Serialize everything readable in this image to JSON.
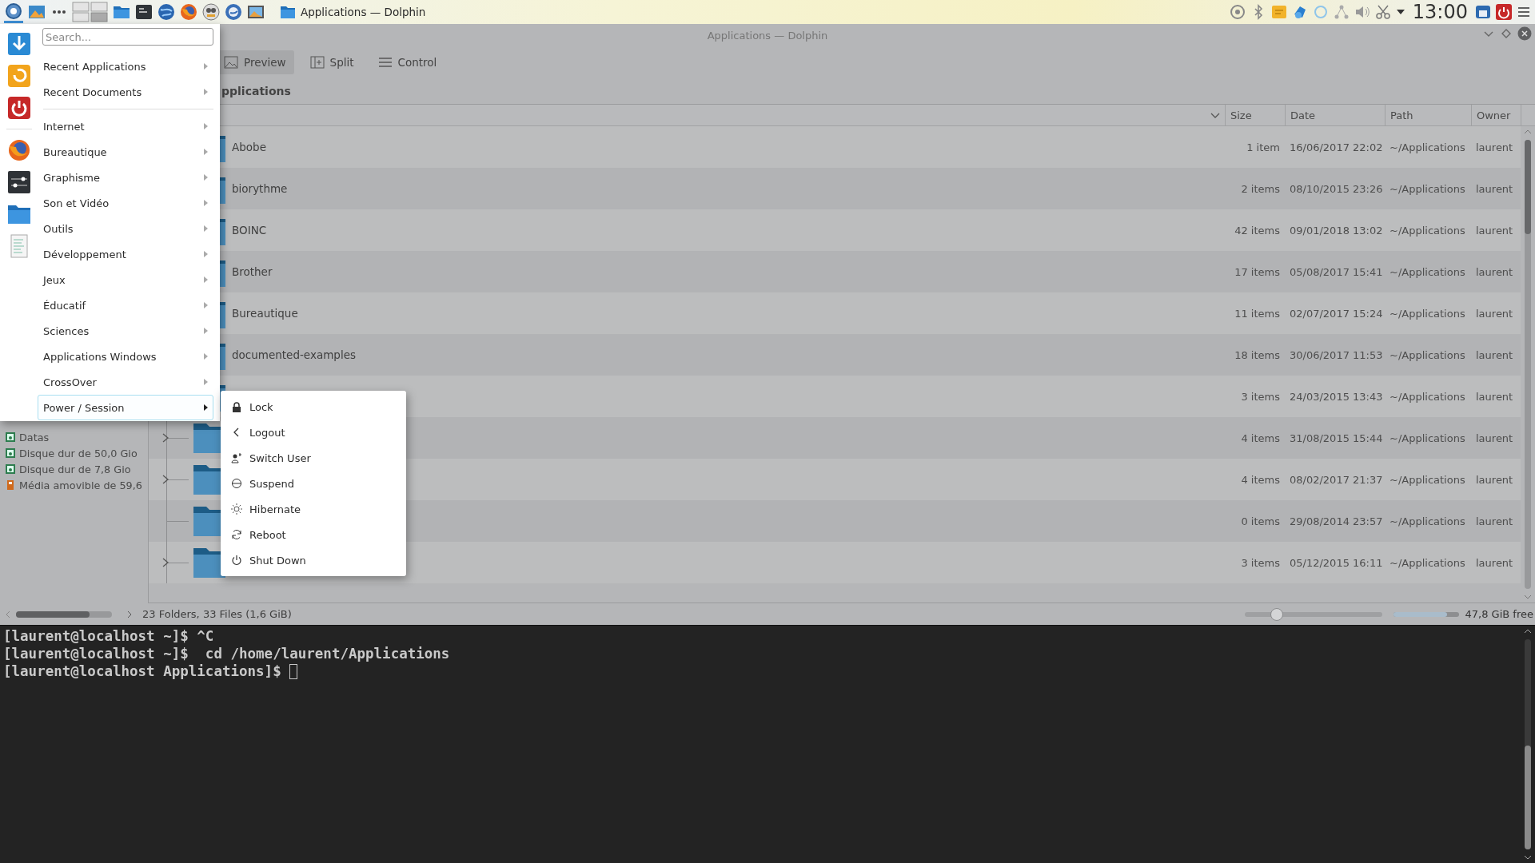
{
  "top_panel": {
    "task": {
      "title": "Applications — Dolphin"
    },
    "clock": "13:00"
  },
  "window": {
    "title": "Applications — Dolphin"
  },
  "toolbar": [
    {
      "label": "Preview",
      "on": true
    },
    {
      "label": "Split",
      "on": false
    },
    {
      "label": "Control",
      "on": false
    }
  ],
  "breadcrumb": "pplications",
  "columns": [
    "Size",
    "Date",
    "Path",
    "Owner"
  ],
  "rows": [
    {
      "name": "Abobe",
      "size": "1 item",
      "date": "16/06/2017 22:02",
      "path": "~/Applications",
      "owner": "laurent",
      "expandable": false
    },
    {
      "name": "biorythme",
      "size": "2 items",
      "date": "08/10/2015 23:26",
      "path": "~/Applications",
      "owner": "laurent",
      "expandable": false
    },
    {
      "name": "BOINC",
      "size": "42 items",
      "date": "09/01/2018 13:02",
      "path": "~/Applications",
      "owner": "laurent",
      "expandable": false
    },
    {
      "name": "Brother",
      "size": "17 items",
      "date": "05/08/2017 15:41",
      "path": "~/Applications",
      "owner": "laurent",
      "expandable": false
    },
    {
      "name": "Bureautique",
      "size": "11 items",
      "date": "02/07/2017 15:24",
      "path": "~/Applications",
      "owner": "laurent",
      "expandable": false
    },
    {
      "name": "documented-examples",
      "size": "18 items",
      "date": "30/06/2017 11:53",
      "path": "~/Applications",
      "owner": "laurent",
      "expandable": false
    },
    {
      "size": "3 items",
      "date": "24/03/2015 13:43",
      "path": "~/Applications",
      "owner": "laurent",
      "expandable": false
    },
    {
      "size": "4 items",
      "date": "31/08/2015 15:44",
      "path": "~/Applications",
      "owner": "laurent",
      "expandable": true
    },
    {
      "size": "4 items",
      "date": "08/02/2017 21:37",
      "path": "~/Applications",
      "owner": "laurent",
      "expandable": true
    },
    {
      "size": "0 items",
      "date": "29/08/2014 23:57",
      "path": "~/Applications",
      "owner": "laurent",
      "expandable": false
    },
    {
      "size": "3 items",
      "date": "05/12/2015 16:11",
      "path": "~/Applications",
      "owner": "laurent",
      "expandable": true
    }
  ],
  "places": [
    "Datas",
    "Disque dur de 50,0 Gio",
    "Disque dur de 7,8 Gio",
    "Média amovible de 59,6"
  ],
  "status_bar": {
    "summary": "23 Folders, 33 Files (1,6 GiB)",
    "zoom": {
      "level": 0.21
    },
    "free_space": {
      "level": 0.82,
      "label": "47,8 GiB free"
    }
  },
  "terminal": {
    "lines": [
      "[laurent@localhost ~]$ ^C",
      "[laurent@localhost ~]$  cd /home/laurent/Applications",
      "[laurent@localhost Applications]$ "
    ]
  },
  "start_menu": {
    "search": {
      "placeholder": "Search..."
    },
    "sections": [
      {
        "items": [
          {
            "label": "Recent Applications",
            "selected": false
          },
          {
            "label": "Recent Documents",
            "selected": false
          }
        ]
      },
      {
        "items": [
          {
            "label": "Internet",
            "selected": false
          },
          {
            "label": "Bureautique",
            "selected": false
          },
          {
            "label": "Graphisme",
            "selected": false
          },
          {
            "label": "Son et Vidéo",
            "selected": false
          },
          {
            "label": "Outils",
            "selected": false
          },
          {
            "label": "Développement",
            "selected": false
          },
          {
            "label": "Jeux",
            "selected": false
          },
          {
            "label": "Éducatif",
            "selected": false
          },
          {
            "label": "Sciences",
            "selected": false
          },
          {
            "label": "Applications Windows",
            "selected": false
          },
          {
            "label": "CrossOver",
            "selected": false
          },
          {
            "label": "Power / Session",
            "selected": true
          }
        ]
      }
    ]
  },
  "power_menu": {
    "items": [
      {
        "label": "Lock"
      },
      {
        "label": "Logout"
      },
      {
        "label": "Switch User"
      },
      {
        "label": "Suspend"
      },
      {
        "label": "Hibernate"
      },
      {
        "label": "Reboot"
      },
      {
        "label": "Shut Down"
      }
    ]
  }
}
